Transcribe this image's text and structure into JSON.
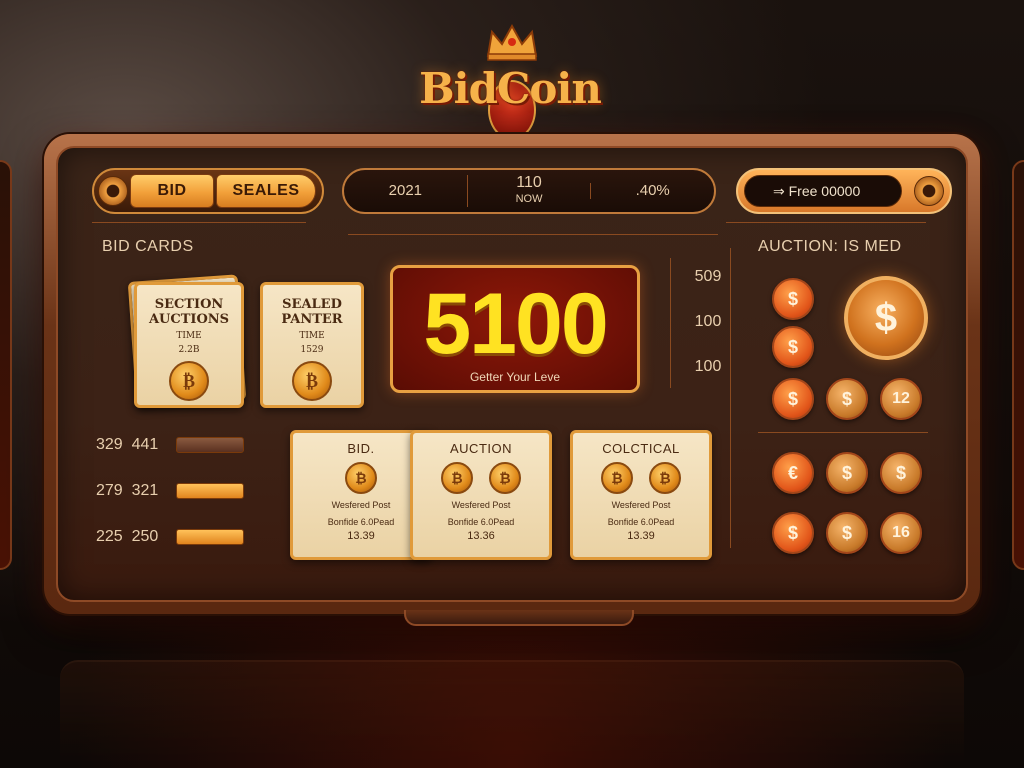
{
  "logo": {
    "text": "BidCoin"
  },
  "topbar": {
    "bid_label": "BID",
    "sealed_label": "SEALES",
    "stats": {
      "year": "2021",
      "value": "110",
      "value_caption": "NOW",
      "percent": ".40%"
    },
    "free_value": "Free 00000",
    "free_prefix": "⇒"
  },
  "sections": {
    "bid_cards": "BID CARDS",
    "auction_status": "AUCTION: IS MED"
  },
  "bid_cards": [
    {
      "title": "SECTION AUCTIONS",
      "sub": "TIME",
      "value": "2.2B"
    },
    {
      "title": "SEALED PANTER",
      "sub": "TIME",
      "value": "1529"
    }
  ],
  "left_list": [
    {
      "a": "329",
      "b": "441",
      "bar": "dark"
    },
    {
      "a": "279",
      "b": "321",
      "bar": "light"
    },
    {
      "a": "225",
      "b": "250",
      "bar": "light"
    }
  ],
  "main_value": {
    "number": "5100",
    "caption": "Getter Your Leve"
  },
  "right_stats": [
    "509",
    "100",
    "100"
  ],
  "auction_cards": [
    {
      "title": "BID.",
      "desc1": "Wesfered Post",
      "desc2": "Bonfide 6.0Pead",
      "price": "13.39"
    },
    {
      "title": "AUCTION",
      "desc1": "Wesfered Post",
      "desc2": "Bonfide 6.0Pead",
      "price": "13.36"
    },
    {
      "title": "COLCTICAL",
      "desc1": "Wesfered Post",
      "desc2": "Bonfide 6.0Pead",
      "price": "13.39"
    }
  ],
  "coins": {
    "big": "$",
    "top": [
      "$",
      "$",
      "$",
      "$",
      "12"
    ],
    "bottom": [
      "€",
      "$",
      "$",
      "$",
      "$",
      "16"
    ]
  },
  "colors": {
    "accent": "#f2a03a",
    "value_yellow": "#ffe222",
    "panel_red": "#8e1808"
  }
}
